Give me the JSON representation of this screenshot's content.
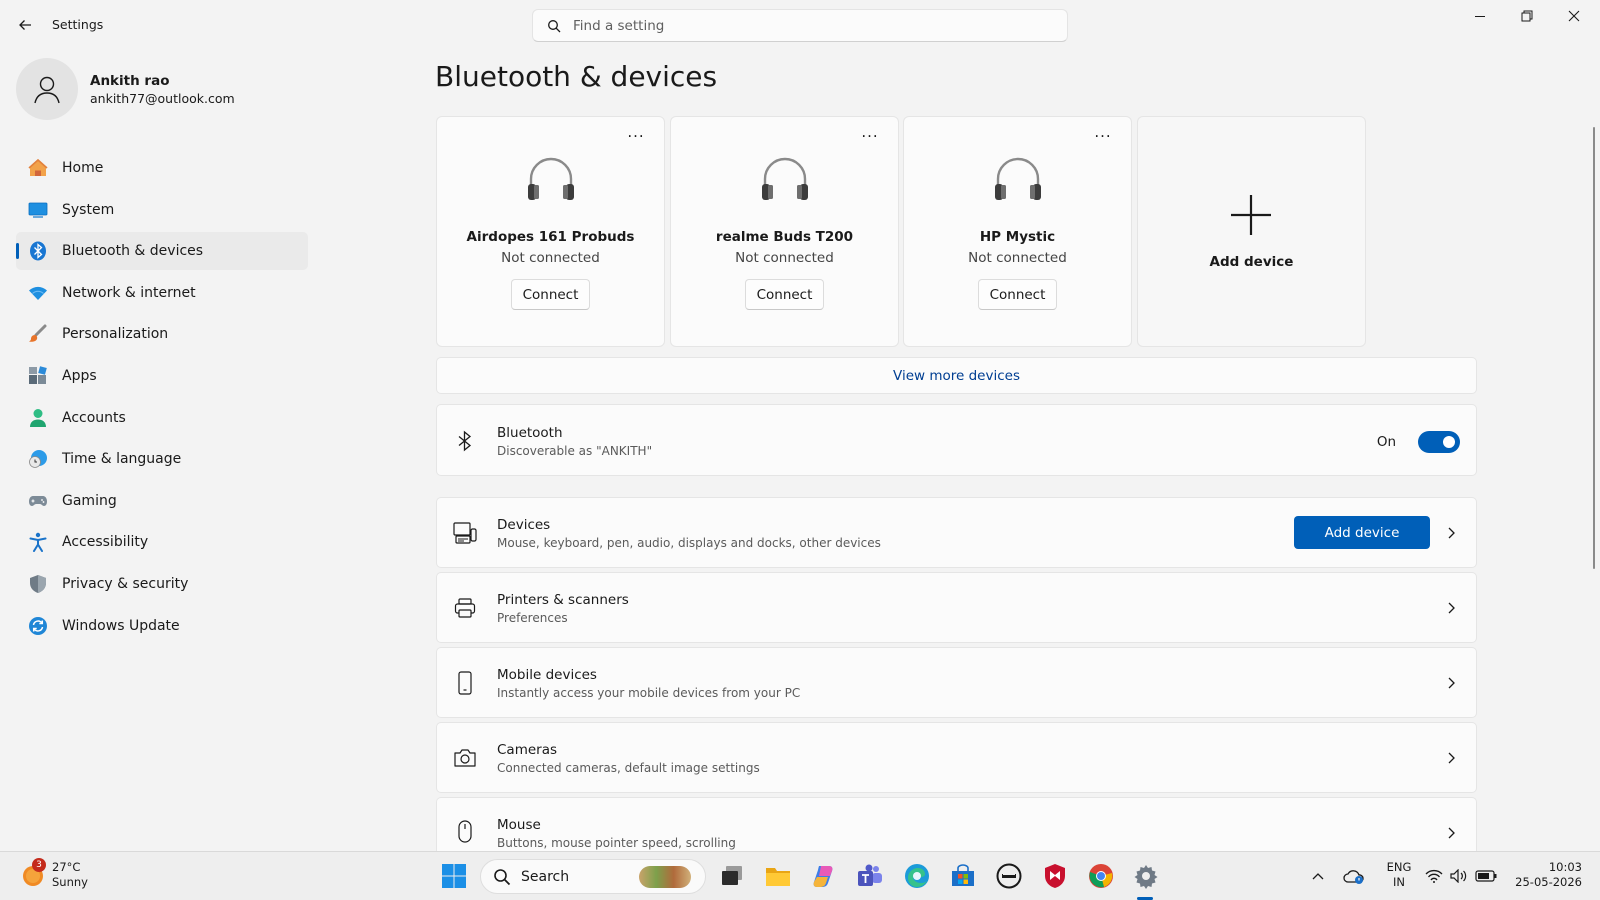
{
  "window": {
    "title": "Settings",
    "search_placeholder": "Find a setting"
  },
  "profile": {
    "name": "Ankith rao",
    "email": "ankith77@outlook.com"
  },
  "sidebar": {
    "items": [
      {
        "label": "Home",
        "icon": "home-icon",
        "active": false
      },
      {
        "label": "System",
        "icon": "system-icon",
        "active": false
      },
      {
        "label": "Bluetooth & devices",
        "icon": "bluetooth-icon",
        "active": true
      },
      {
        "label": "Network & internet",
        "icon": "wifi-icon",
        "active": false
      },
      {
        "label": "Personalization",
        "icon": "brush-icon",
        "active": false
      },
      {
        "label": "Apps",
        "icon": "apps-icon",
        "active": false
      },
      {
        "label": "Accounts",
        "icon": "accounts-icon",
        "active": false
      },
      {
        "label": "Time & language",
        "icon": "clock-globe-icon",
        "active": false
      },
      {
        "label": "Gaming",
        "icon": "gamepad-icon",
        "active": false
      },
      {
        "label": "Accessibility",
        "icon": "accessibility-icon",
        "active": false
      },
      {
        "label": "Privacy & security",
        "icon": "shield-icon",
        "active": false
      },
      {
        "label": "Windows Update",
        "icon": "update-icon",
        "active": false
      }
    ]
  },
  "main": {
    "title": "Bluetooth & devices",
    "devices": [
      {
        "name": "Airdopes 161 Probuds",
        "status": "Not connected",
        "action": "Connect",
        "more": "..."
      },
      {
        "name": "realme Buds T200",
        "status": "Not connected",
        "action": "Connect",
        "more": "..."
      },
      {
        "name": "HP Mystic",
        "status": "Not connected",
        "action": "Connect",
        "more": "..."
      }
    ],
    "add_device_card": "Add device",
    "view_more": "View more devices",
    "bluetooth": {
      "title": "Bluetooth",
      "subtitle": "Discoverable as \"ANKITH\"",
      "state_label": "On",
      "enabled": true
    },
    "rows": [
      {
        "title": "Devices",
        "subtitle": "Mouse, keyboard, pen, audio, displays and docks, other devices",
        "button": "Add device"
      },
      {
        "title": "Printers & scanners",
        "subtitle": "Preferences"
      },
      {
        "title": "Mobile devices",
        "subtitle": "Instantly access your mobile devices from your PC"
      },
      {
        "title": "Cameras",
        "subtitle": "Connected cameras, default image settings"
      },
      {
        "title": "Mouse",
        "subtitle": "Buttons, mouse pointer speed, scrolling"
      }
    ]
  },
  "taskbar": {
    "weather": {
      "temp": "27°C",
      "condition": "Sunny",
      "badge": "3"
    },
    "search_label": "Search",
    "language": {
      "line1": "ENG",
      "line2": "IN"
    },
    "time": "10:03",
    "date": "25-05-2026"
  },
  "colors": {
    "accent": "#005fb8",
    "link": "#003e92",
    "background": "#f3f3f3",
    "card": "#fbfbfb"
  }
}
